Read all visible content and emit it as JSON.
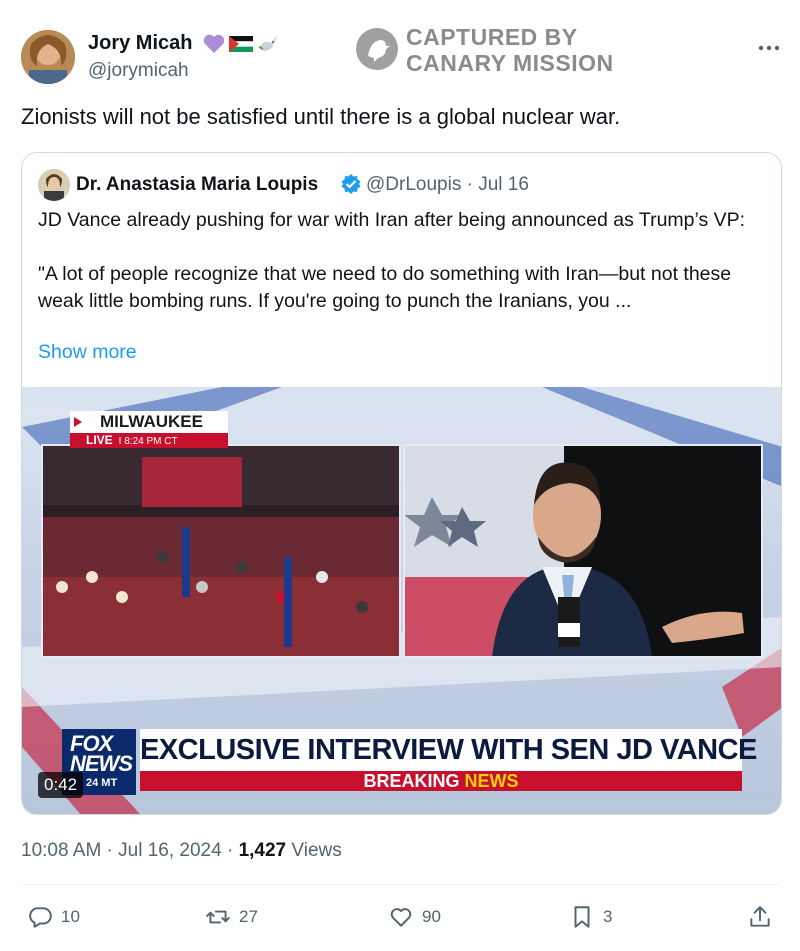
{
  "author": {
    "name": "Jory Micah",
    "handle": "@jorymicah"
  },
  "watermark": {
    "line1": "CAPTURED BY",
    "line2": "CANARY MISSION"
  },
  "tweet": {
    "text": "Zionists will not be satisfied until there is a global nuclear war.",
    "timestamp": "10:08 AM · Jul 16, 2024 · ",
    "views_count": "1,427",
    "views_label": " Views"
  },
  "quote": {
    "name": "Dr. Anastasia Maria Loupis",
    "handle_date": "@DrLoupis · Jul 16",
    "line1": "JD Vance already pushing for war with Iran after being announced as Trump’s VP:",
    "line2": "\"A lot of people recognize that we need to do something with Iran—but not these weak little bombing runs.  If you're going to punch the Iranians, you ...",
    "show_more": "Show more"
  },
  "video": {
    "location": "MILWAUKEE",
    "live": "LIVE",
    "live_time": "I 8:24 PM CT",
    "fox_line1": "FOX",
    "fox_line2": "NEWS",
    "fox_line3": "24 MT",
    "headline": "EXCLUSIVE INTERVIEW WITH SEN JD VANCE",
    "breaking": "BREAKING ",
    "breaking_news": "NEWS",
    "duration": "0:42"
  },
  "actions": {
    "replies": "10",
    "reposts": "27",
    "likes": "90",
    "bookmarks": "3"
  },
  "colors": {
    "accent": "#1d9bf0",
    "secondary_text": "#536471",
    "fox_red": "#c8102e",
    "fox_blue": "#0b2a6b"
  }
}
